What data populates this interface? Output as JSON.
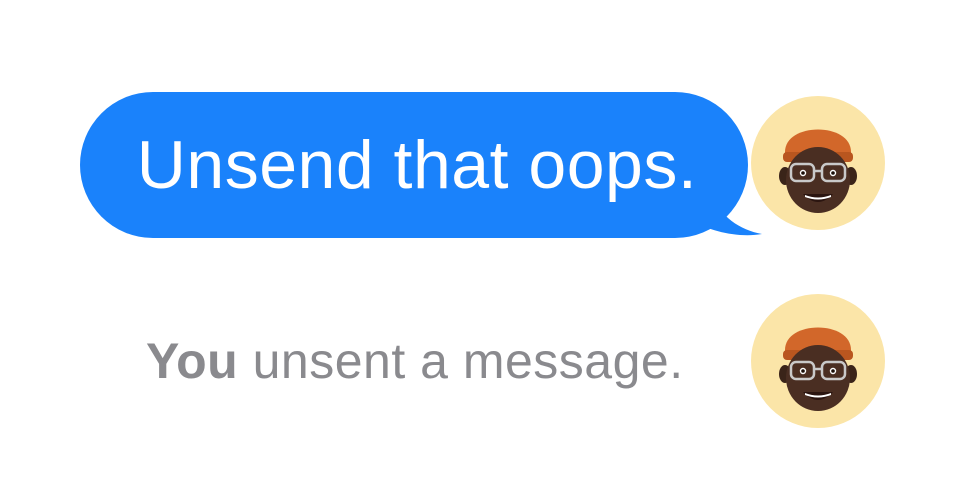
{
  "conversation": {
    "sent_message": {
      "text": "Unsend that oops."
    },
    "unsent_notice": {
      "subject": "You",
      "text": " unsent a message."
    },
    "colors": {
      "bubble": "#1a82fb",
      "bubble_text": "#ffffff",
      "notice_text": "#8a8a8e",
      "avatar_background": "#fbe5a8"
    },
    "avatar": {
      "icon": "memoji-avatar-icon"
    }
  }
}
